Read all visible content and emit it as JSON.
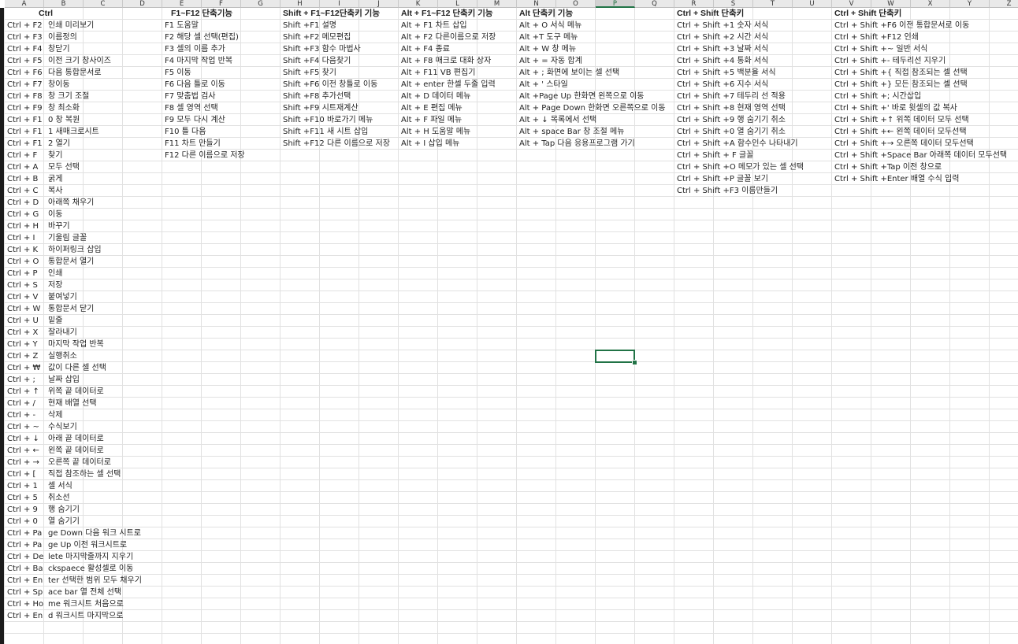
{
  "sheet": {
    "columns": [
      "A",
      "B",
      "C",
      "D",
      "E",
      "F",
      "G",
      "H",
      "I",
      "J",
      "K",
      "L",
      "M",
      "N",
      "O",
      "P",
      "Q",
      "R",
      "S",
      "T",
      "U",
      "V",
      "W",
      "X",
      "Y",
      "Z"
    ],
    "selected_column": "P",
    "header_row": [
      {
        "col": "A",
        "text": "Ctrl"
      },
      {
        "col": "E",
        "text": "F1~F12 단축기능"
      },
      {
        "col": "H",
        "text": "Shift + F1~F12단축키 기능"
      },
      {
        "col": "K",
        "text": "Alt + F1~F12 단축키 기능"
      },
      {
        "col": "N",
        "text": "Alt 단축키 기능"
      },
      {
        "col": "R",
        "text": "Ctrl + Shift 단축키"
      },
      {
        "col": "V",
        "text": "Ctrl + Shift 단축키"
      }
    ],
    "ctrl_rows": [
      {
        "a": "Ctrl + F2",
        "b": "인쇄 미리보기"
      },
      {
        "a": "Ctrl + F3",
        "b": "이름정의"
      },
      {
        "a": "Ctrl + F4",
        "b": "창닫기"
      },
      {
        "a": "Ctrl + F5",
        "b": "이전 크기 창사이즈"
      },
      {
        "a": "Ctrl + F6",
        "b": "다음 통합문서로"
      },
      {
        "a": "Ctrl + F7",
        "b": "창이동"
      },
      {
        "a": "Ctrl + F8",
        "b": "창 크기 조절"
      },
      {
        "a": "Ctrl + F9",
        "b": "창 최소화"
      },
      {
        "a": "Ctrl + F1",
        "b": "0 창 복원"
      },
      {
        "a": "Ctrl + F1",
        "b": "1 새매크로시트"
      },
      {
        "a": "Ctrl + F1",
        "b": "2 열기"
      },
      {
        "a": "Ctrl + F",
        "b": "찾기"
      },
      {
        "a": "Ctrl + A",
        "b": "모두 선택"
      },
      {
        "a": "Ctrl + B",
        "b": "굵게"
      },
      {
        "a": "Ctrl + C",
        "b": "복사"
      },
      {
        "a": "Ctrl + D",
        "b": "아래쪽 채우기"
      },
      {
        "a": "Ctrl + G",
        "b": "이동"
      },
      {
        "a": "Ctrl + H",
        "b": "바꾸기"
      },
      {
        "a": "Ctrl + I",
        "b": "기울림 글꼴"
      },
      {
        "a": "Ctrl + K",
        "b": "하이퍼링크 삽입"
      },
      {
        "a": "Ctrl + O",
        "b": "통합문서 열기"
      },
      {
        "a": "Ctrl + P",
        "b": "인쇄"
      },
      {
        "a": "Ctrl + S",
        "b": "저장"
      },
      {
        "a": "Ctrl + V",
        "b": "붙여넣기"
      },
      {
        "a": "Ctrl + W",
        "b": "통합문서 닫기"
      },
      {
        "a": "Ctrl + U",
        "b": "밑줄"
      },
      {
        "a": "Ctrl + X",
        "b": "잘라내기"
      },
      {
        "a": "Ctrl + Y",
        "b": "마지막 작업 반복"
      },
      {
        "a": "Ctrl + Z",
        "b": "실행취소"
      },
      {
        "a": "Ctrl + ₩",
        "b": "값이 다른 셀 선택"
      },
      {
        "a": "Ctrl + ;",
        "b": "날짜 삽입"
      },
      {
        "a": "Ctrl + ↑",
        "b": "위쪽 끝 데이터로"
      },
      {
        "a": "Ctrl + /",
        "b": "현재 배열 선택"
      },
      {
        "a": "Ctrl + -",
        "b": "삭제"
      },
      {
        "a": "Ctrl + ~",
        "b": "수식보기"
      },
      {
        "a": "Ctrl + ↓",
        "b": "아래 끝 데이터로"
      },
      {
        "a": "Ctrl + ←",
        "b": "왼쪽 끝 데이터로"
      },
      {
        "a": "Ctrl + →",
        "b": "오른쪽 끝 데이터로"
      },
      {
        "a": "Ctrl + [",
        "b": "직접 참조하는 셀 선택"
      },
      {
        "a": "Ctrl + 1",
        "b": "셀 서식"
      },
      {
        "a": "Ctrl + 5",
        "b": "취소선"
      },
      {
        "a": "Ctrl + 9",
        "b": "행 숨기기"
      },
      {
        "a": "Ctrl + 0",
        "b": "열 숨기기"
      },
      {
        "a": "Ctrl + Pa",
        "b": "ge Down 다음 워크 시트로"
      },
      {
        "a": "Ctrl + Pa",
        "b": "ge Up 이전 워크시트로"
      },
      {
        "a": "Ctrl + De",
        "b": "lete 마지막줄까지 지우기"
      },
      {
        "a": "Ctrl + Ba",
        "b": "ckspaece 활성셀로 이동"
      },
      {
        "a": "Ctrl + En",
        "b": "ter 선택한 범위 모두 채우기"
      },
      {
        "a": "Ctrl + Sp",
        "b": "ace bar 열 전체 선택"
      },
      {
        "a": "Ctrl + Ho",
        "b": "me 워크시트 처음으로"
      },
      {
        "a": "Ctrl + En",
        "b": "d 워크시트 마지막으로"
      }
    ],
    "col_e": [
      "F1 도움말",
      "F2 해당 셀 선택(편집)",
      "F3 셀의 이름 추가",
      "F4 마지막 작업 반복",
      "F5 이동",
      "F6 다음 틀로 이동",
      "F7 맞춤법 검사",
      "F8 셀 영역 선택",
      "F9 모두 다시 계산",
      "F10 틀 다음",
      "F11 차트 만들기",
      "F12 다른 이름으로 저장"
    ],
    "col_h": [
      "Shift +F1 설명",
      "Shift +F2 메모편집",
      "Shift +F3 함수 마법사",
      "Shift +F4 다음찾기",
      "Shift +F5 찾기",
      "Shift +F6 이전 창틀로 이동",
      "Shift +F8 추가선택",
      "Shift +F9 시트재계산",
      "Shift +F10 바로가기 메뉴",
      "Shift +F11 새 시트 삽입",
      "Shift +F12 다른 이름으로 저장"
    ],
    "col_k": [
      "Alt + F1 차트 삽입",
      "Alt + F2 다른이름으로 저장",
      "Alt + F4 종료",
      "Alt + F8 매크로 대화 상자",
      "Alt + F11 VB 편집기",
      "Alt + enter 한셀 두줄 입력",
      "Alt + D 데이터 메뉴",
      "Alt + E 편집 메뉴",
      "Alt + F 파일 메뉴",
      "Alt + H 도움말 메뉴",
      "Alt + I 삽입 메뉴"
    ],
    "col_n": [
      "Alt + O 서식 메뉴",
      "Alt +T 도구 메뉴",
      "Alt + W 창 메뉴",
      "Alt + = 자동 합계",
      "Alt + ; 화면에 보이는 셀 선택",
      "Alt + ' 스타일",
      "Alt +Page Up 한화면 왼쪽으로 이동",
      "Alt + Page Down 한화면 오른쪽으로 이동",
      "Alt + ↓ 목록에서 선택",
      "Alt + space Bar 창 조절 메뉴",
      "Alt + Tap 다음 응용프로그램 가기"
    ],
    "col_r": [
      "Ctrl + Shift +1 숫자 서식",
      "Ctrl + Shift +2 시간 서식",
      "Ctrl + Shift +3 날짜 서식",
      "Ctrl + Shift +4 통화 서식",
      "Ctrl + Shift +5 백분율 서식",
      "Ctrl + Shift +6 지수 서식",
      "Ctrl + Shift +7 테두리 선 적용",
      "Ctrl + Shift +8 현재 영역 선택",
      "Ctrl + Shift +9 행 숨기기 취소",
      "Ctrl + Shift +0 열 숨기기 취소",
      "Ctrl + Shift +A 함수인수 나타내기",
      "Ctrl + Shift + F 글꼴",
      "Ctrl + Shift +O 메모가 있는 셀 선택",
      "Ctrl + Shift +P 글꼴 보기",
      "Ctrl + Shift +F3 이름만들기"
    ],
    "col_v": [
      "Ctrl + Shift +F6 이전 통합문서로 이동",
      "Ctrl + Shift +F12 인쇄",
      "Ctrl + Shift +~ 일반 서식",
      "Ctrl + Shift +- 테두리선 지우기",
      "Ctrl + Shift +{ 직접 참조되는 셀 선택",
      "Ctrl + Shift +} 모든 참조되는 셀 선택",
      "Ctrl + Shift +; 시간삽입",
      "Ctrl + Shift +' 바로 윗셀의 값 복사",
      "Ctrl + Shift +↑ 위쪽 데이터 모두 선택",
      "Ctrl + Shift +← 왼쪽 데이터 모두선택",
      "Ctrl + Shift +→ 오른쪽 데이터 모두선택",
      "Ctrl + Shift +Space Bar 아래쪽 데이터 모두선택",
      "Ctrl + Shift +Tap 이전 창으로",
      "Ctrl + Shift +Enter 배열 수식 입력"
    ],
    "active_cell": "P30"
  }
}
